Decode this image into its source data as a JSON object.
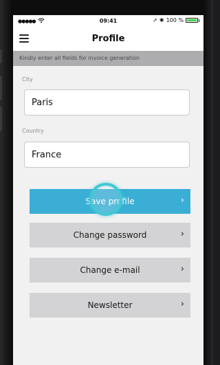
{
  "status_bar": {
    "signal": "●●●●●",
    "wifi_icon": "wifi-icon",
    "time": "09:41",
    "location_icon": "➚",
    "bluetooth_icon": "✱",
    "battery_percent": "100 %",
    "battery_level": 1.0,
    "battery_color": "#3bd24d"
  },
  "nav": {
    "title": "Profile",
    "menu_icon": "hamburger-menu-icon"
  },
  "notice": {
    "text": "Kindly enter all fields for invoice generation"
  },
  "form": {
    "city": {
      "label": "City",
      "value": "Paris"
    },
    "country": {
      "label": "Country",
      "value": "France"
    }
  },
  "buttons": {
    "save_profile": "Save profile",
    "change_password": "Change password",
    "change_email": "Change e-mail",
    "newsletter": "Newsletter",
    "chevron": "›"
  },
  "colors": {
    "primary_button": "#3aaed5",
    "secondary_button": "#d3d3d5",
    "notice_bar": "#adadb0",
    "tap_ring": "#43c7d4"
  }
}
